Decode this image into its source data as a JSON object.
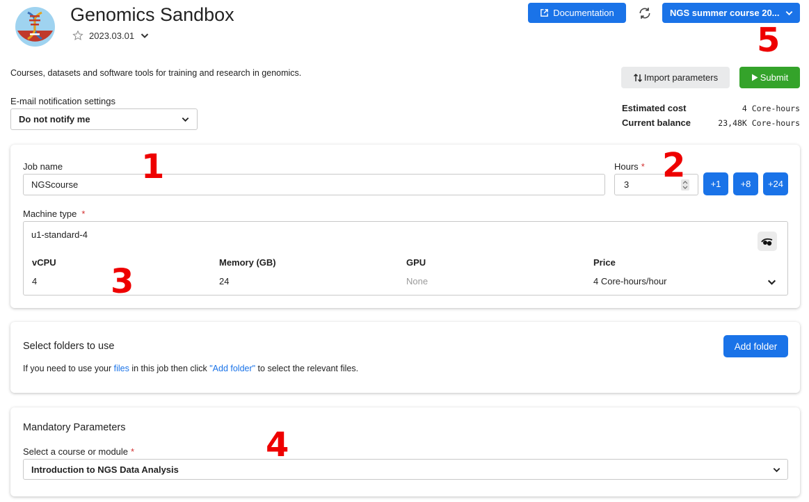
{
  "app": {
    "title": "Genomics Sandbox",
    "version": "2023.03.01",
    "description": "Courses, datasets and software tools for training and research in genomics."
  },
  "header": {
    "documentation_label": "Documentation",
    "project_label": "NGS summer course 20..."
  },
  "actions": {
    "import_label": "Import parameters",
    "submit_label": "Submit"
  },
  "notifications": {
    "label": "E-mail notification settings",
    "value": "Do not notify me"
  },
  "cost": {
    "estimated_label": "Estimated cost",
    "estimated_value": "4 Core-hours",
    "balance_label": "Current balance",
    "balance_value": "23,48K Core-hours"
  },
  "job": {
    "name_label": "Job name",
    "name_value": "NGScourse",
    "hours_label": "Hours",
    "hours_required": "*",
    "hours_value": "3",
    "plus1": "+1",
    "plus8": "+8",
    "plus24": "+24",
    "machine_label": "Machine type",
    "machine_required": "*",
    "machine_value": "u1-standard-4",
    "specs": {
      "vcpu_header": "vCPU",
      "memory_header": "Memory (GB)",
      "gpu_header": "GPU",
      "price_header": "Price",
      "vcpu_value": "4",
      "memory_value": "24",
      "gpu_value": "None",
      "price_value": "4 Core-hours/hour"
    }
  },
  "folders": {
    "title": "Select folders to use",
    "add_label": "Add folder",
    "hint_prefix": "If you need to use your ",
    "hint_link": "files",
    "hint_middle": " in this job then click ",
    "hint_quote": "\"Add folder\"",
    "hint_suffix": " to select the relevant files."
  },
  "mandatory": {
    "title": "Mandatory Parameters",
    "course_label": "Select a course or module",
    "course_required": "*",
    "course_value": "Introduction to NGS Data Analysis"
  },
  "markers": {
    "m1": "1",
    "m2": "2",
    "m3": "3",
    "m4": "4",
    "m5": "5"
  },
  "colors": {
    "primary": "#1a73e8",
    "submit": "#34a32a",
    "marker": "#ee0000",
    "required": "#d32f2f"
  }
}
